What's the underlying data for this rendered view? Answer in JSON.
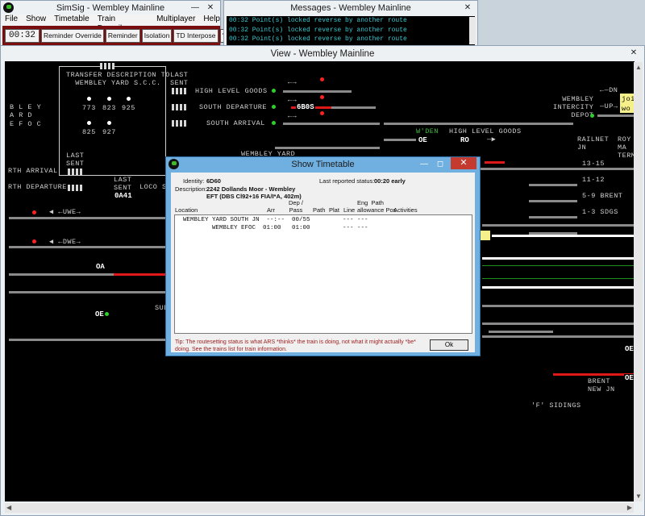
{
  "simsig": {
    "title": "SimSig - Wembley Mainline",
    "menu": [
      "File",
      "Show",
      "Timetable",
      "Train Describer",
      "Multiplayer",
      "Help"
    ],
    "clock": "00:32",
    "buttons": [
      "Reminder Override",
      "Reminder",
      "Isolation",
      "TD Interpose"
    ],
    "phone_icon": "phone-icon",
    "printer_icon": "printer-icon"
  },
  "messages": {
    "title": "Messages - Wembley Mainline",
    "items": [
      "00:32 Point(s) locked reverse by another route",
      "00:32 Point(s) locked reverse by another route",
      "00:32 Point(s) locked reverse by another route"
    ]
  },
  "view": {
    "title": "View - Wembley Mainline",
    "labels": {
      "tsc": "TRANSFER DESCRIPTION TO\nWEMBLEY YARD S.C.C.",
      "n773": "773",
      "n823": "823",
      "n925": "925",
      "n825": "825",
      "n927": "927",
      "last_sent_1": "LAST\nSENT",
      "last_sent_2": "LAST\nSENT",
      "last_sent_3": "LAST\nSENT",
      "high_level_goods_1": "HIGH LEVEL GOODS",
      "south_departure": "SOUTH DEPARTURE",
      "south_arrival": "SOUTH ARRIVAL",
      "wembley_yard": "WEMBLEY YARD",
      "high_level_goods_2": "HIGH LEVEL GOODS",
      "wembley_intercity_depot": "WEMBLEY\nINTERCITY\nDEPOT",
      "dn": "DN",
      "up": "UP",
      "railnet_jn": "RAILNET\nJN",
      "roy_terminal": "ROY\nMA\nTERMI",
      "r13_15": "13-15",
      "r11_12": "11-12",
      "r5_9": "5-9 BRENT",
      "r1_3": "1-3 SDGS",
      "bley": "B L E Y",
      "ard": "A R D",
      "efoc": "E F O C",
      "rth_arrival": "RTH ARRIVAL",
      "rth_departure": "RTH DEPARTURE",
      "loco_si": "LOCO SI",
      "uwe": "UWE",
      "dwe": "DWE",
      "sud": "SUD",
      "wden": "W'DEN",
      "brent_new_jn": "BRENT\nNEW JN",
      "f_sidings": "'F' SIDINGS",
      "joi": "joi",
      "wo": "wo"
    },
    "berths": {
      "g80s": "6B0S",
      "b0a41": "0A41",
      "oe1": "OE",
      "ro": "RO",
      "oe2": "OE",
      "oa1": "OA",
      "oe_right": "OE",
      "oe_right2": "OE"
    }
  },
  "timetable": {
    "title": "Show Timetable",
    "identity_label": "Identity:",
    "identity": "6D60",
    "description_label": "Description:",
    "description_1": "2242 Dollands Moor - Wembley",
    "description_2": "EFT (DBS Cl92+16 FIA/I*A, 402m)",
    "status_label": "Last reported status:",
    "status": "00:20  early",
    "headers": {
      "location": "Location",
      "arr": "Arr",
      "dep": "Dep /\nPass",
      "path": "Path",
      "plat": "Plat",
      "line": "Line",
      "eng": "Eng  Path\nallowance Pos",
      "activities": "Activities"
    },
    "rows": [
      "WEMBLEY YARD SOUTH JN  --:--  00/55         --- ---",
      "        WEMBLEY EFOC  01:00   01:00         --- ---"
    ],
    "tip": "Tip: The routesetting status is what ARS *thinks* the train is doing, not what it might actually *be* doing. See the trains list for train information.",
    "ok_label": "Ok"
  }
}
